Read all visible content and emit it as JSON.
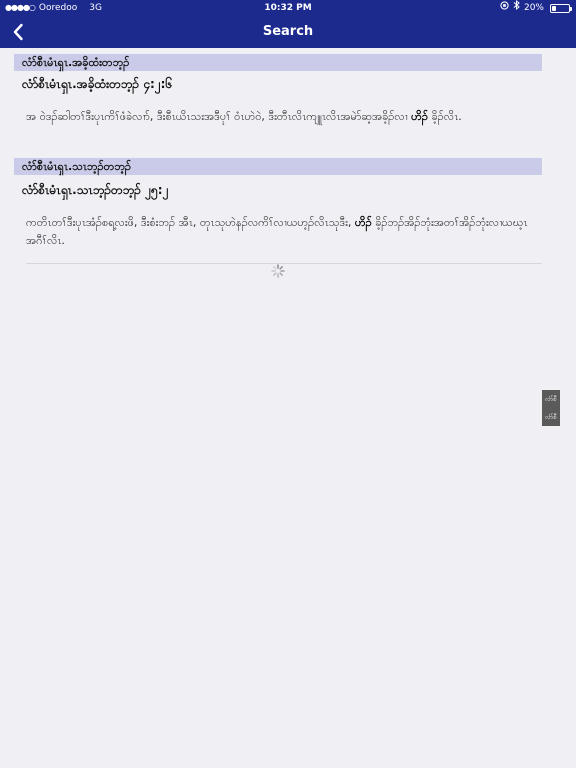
{
  "status_bar": {
    "carrier": "Ooredoo",
    "network": "3G",
    "time": "10:32 PM",
    "battery_percent": "20%",
    "battery_level": 0.2
  },
  "nav": {
    "back_icon": "chevron-left-icon",
    "title": "Search"
  },
  "results": [
    {
      "section": "လံာ်စီၤမံၤရှၤ.အခိ့ထံးတဘ့ၣ်",
      "title": "လံာ်စီၤမံၤရှၤ.အခိ့ထံးတဘ့ၣ် ၄:၂:၆",
      "text_before": "အ ဝဲဒၣ်ဆါတၢ်ဒီးပုၤကိၢ်ဖံခဲလၢာ်, ဒီးစီၤယိၤသးအဒီပုၢ် ဝံၤဟဲဝဲ, ဒီးတီၤလိၤကျူၤလိၤအမဲာ်ဆ့အခိ့ၣ်လၢ",
      "highlight": "ဟိၣ်",
      "text_after": "ခိ့ၣ်လိၤ."
    },
    {
      "section": "လံာ်စီၤမံၤရှၤ.သၤဘ့ၣ်တဘ့ၣ်",
      "title": "လံာ်စီၤမံၤရှၤ.သၤဘ့ၣ်တဘ့ၣ် ၂၅:၂",
      "text_before": "ကတိၤတၢ်ဒီးပုၤအံၣ်စရ့လးဖိ, ဒီးစံးဘၣ် အီၤ, တုၤသုဟဲနၣ်လကိၢ်လၢယဟ့ၣ်လိၤသုဒီး,",
      "highlight": "ဟိၣ်",
      "text_after": "ခိ့ၣ်ဘၣ်အိၣ်ဘုံးအတၢ်အိၣ်ဘုံးလၢယဃ့ၤအဂီၢ်လိၤ."
    }
  ],
  "side_index": {
    "items": [
      "လံာ်စီ",
      "လံာ်စီ"
    ]
  }
}
